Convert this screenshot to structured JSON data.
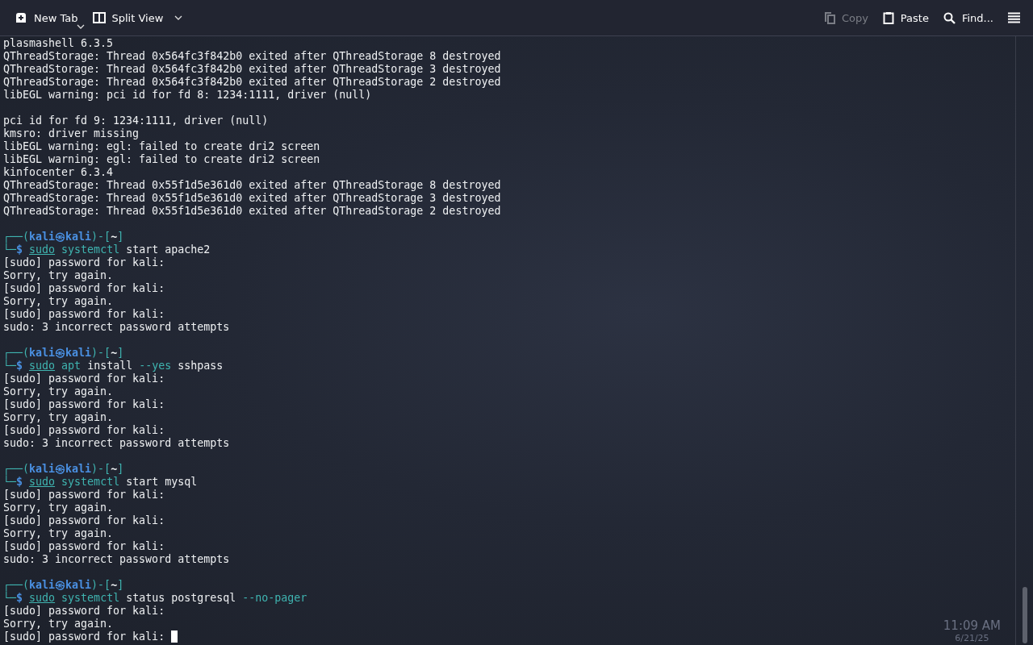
{
  "toolbar": {
    "left": [
      {
        "kind": "newtab",
        "label": "New Tab",
        "disabled": false
      },
      {
        "kind": "split",
        "label": "Split View",
        "disabled": false
      }
    ],
    "right": [
      {
        "kind": "copy",
        "label": "Copy",
        "disabled": true
      },
      {
        "kind": "paste",
        "label": "Paste",
        "disabled": false
      },
      {
        "kind": "find",
        "label": "Find...",
        "disabled": false
      },
      {
        "kind": "menu",
        "disabled": false
      }
    ]
  },
  "terminal": {
    "lines": [
      {
        "kind": "plain",
        "text": "plasmashell 6.3.5"
      },
      {
        "kind": "plain",
        "text": "QThreadStorage: Thread 0x564fc3f842b0 exited after QThreadStorage 8 destroyed"
      },
      {
        "kind": "plain",
        "text": "QThreadStorage: Thread 0x564fc3f842b0 exited after QThreadStorage 3 destroyed"
      },
      {
        "kind": "plain",
        "text": "QThreadStorage: Thread 0x564fc3f842b0 exited after QThreadStorage 2 destroyed"
      },
      {
        "kind": "plain",
        "text": "libEGL warning: pci id for fd 8: 1234:1111, driver (null)"
      },
      {
        "kind": "blank"
      },
      {
        "kind": "plain",
        "text": "pci id for fd 9: 1234:1111, driver (null)"
      },
      {
        "kind": "plain",
        "text": "kmsro: driver missing"
      },
      {
        "kind": "plain",
        "text": "libEGL warning: egl: failed to create dri2 screen"
      },
      {
        "kind": "plain",
        "text": "libEGL warning: egl: failed to create dri2 screen"
      },
      {
        "kind": "plain",
        "text": "kinfocenter 6.3.4"
      },
      {
        "kind": "plain",
        "text": "QThreadStorage: Thread 0x55f1d5e361d0 exited after QThreadStorage 8 destroyed"
      },
      {
        "kind": "plain",
        "text": "QThreadStorage: Thread 0x55f1d5e361d0 exited after QThreadStorage 3 destroyed"
      },
      {
        "kind": "plain",
        "text": "QThreadStorage: Thread 0x55f1d5e361d0 exited after QThreadStorage 2 destroyed"
      },
      {
        "kind": "blank"
      },
      {
        "kind": "prompt",
        "open": "┌──(",
        "user": "kali",
        "at": "㉿",
        "host": "kali",
        "mid": ")-[",
        "dir": "~",
        "close": "]",
        "corner": "└─",
        "dollar": "$",
        "tokens": [
          {
            "kind": "sudo",
            "text": "sudo"
          },
          {
            "kind": "cmd",
            "text": "systemctl"
          },
          {
            "kind": "arg",
            "text": "start"
          },
          {
            "kind": "arg",
            "text": "apache2"
          }
        ]
      },
      {
        "kind": "plain",
        "text": "[sudo] password for kali:"
      },
      {
        "kind": "plain",
        "text": "Sorry, try again."
      },
      {
        "kind": "plain",
        "text": "[sudo] password for kali:"
      },
      {
        "kind": "plain",
        "text": "Sorry, try again."
      },
      {
        "kind": "plain",
        "text": "[sudo] password for kali:"
      },
      {
        "kind": "plain",
        "text": "sudo: 3 incorrect password attempts"
      },
      {
        "kind": "blank"
      },
      {
        "kind": "prompt",
        "open": "┌──(",
        "user": "kali",
        "at": "㉿",
        "host": "kali",
        "mid": ")-[",
        "dir": "~",
        "close": "]",
        "corner": "└─",
        "dollar": "$",
        "tokens": [
          {
            "kind": "sudo",
            "text": "sudo"
          },
          {
            "kind": "cmd",
            "text": "apt"
          },
          {
            "kind": "arg",
            "text": "install"
          },
          {
            "kind": "opt",
            "text": "--yes"
          },
          {
            "kind": "arg",
            "text": "sshpass"
          }
        ]
      },
      {
        "kind": "plain",
        "text": "[sudo] password for kali:"
      },
      {
        "kind": "plain",
        "text": "Sorry, try again."
      },
      {
        "kind": "plain",
        "text": "[sudo] password for kali:"
      },
      {
        "kind": "plain",
        "text": "Sorry, try again."
      },
      {
        "kind": "plain",
        "text": "[sudo] password for kali:"
      },
      {
        "kind": "plain",
        "text": "sudo: 3 incorrect password attempts"
      },
      {
        "kind": "blank"
      },
      {
        "kind": "prompt",
        "open": "┌──(",
        "user": "kali",
        "at": "㉿",
        "host": "kali",
        "mid": ")-[",
        "dir": "~",
        "close": "]",
        "corner": "└─",
        "dollar": "$",
        "tokens": [
          {
            "kind": "sudo",
            "text": "sudo"
          },
          {
            "kind": "cmd",
            "text": "systemctl"
          },
          {
            "kind": "arg",
            "text": "start"
          },
          {
            "kind": "arg",
            "text": "mysql"
          }
        ]
      },
      {
        "kind": "plain",
        "text": "[sudo] password for kali:"
      },
      {
        "kind": "plain",
        "text": "Sorry, try again."
      },
      {
        "kind": "plain",
        "text": "[sudo] password for kali:"
      },
      {
        "kind": "plain",
        "text": "Sorry, try again."
      },
      {
        "kind": "plain",
        "text": "[sudo] password for kali:"
      },
      {
        "kind": "plain",
        "text": "sudo: 3 incorrect password attempts"
      },
      {
        "kind": "blank"
      },
      {
        "kind": "prompt",
        "open": "┌──(",
        "user": "kali",
        "at": "㉿",
        "host": "kali",
        "mid": ")-[",
        "dir": "~",
        "close": "]",
        "corner": "└─",
        "dollar": "$",
        "tokens": [
          {
            "kind": "sudo",
            "text": "sudo"
          },
          {
            "kind": "cmd",
            "text": "systemctl"
          },
          {
            "kind": "arg",
            "text": "status"
          },
          {
            "kind": "arg",
            "text": "postgresql"
          },
          {
            "kind": "opt",
            "text": "--no-pager"
          }
        ]
      },
      {
        "kind": "plain",
        "text": "[sudo] password for kali:"
      },
      {
        "kind": "plain",
        "text": "Sorry, try again."
      },
      {
        "kind": "plain",
        "text": "[sudo] password for kali:",
        "cursor": true
      }
    ]
  },
  "taskbar_clock": {
    "time": "11:09 AM",
    "date": "6/21/25"
  }
}
